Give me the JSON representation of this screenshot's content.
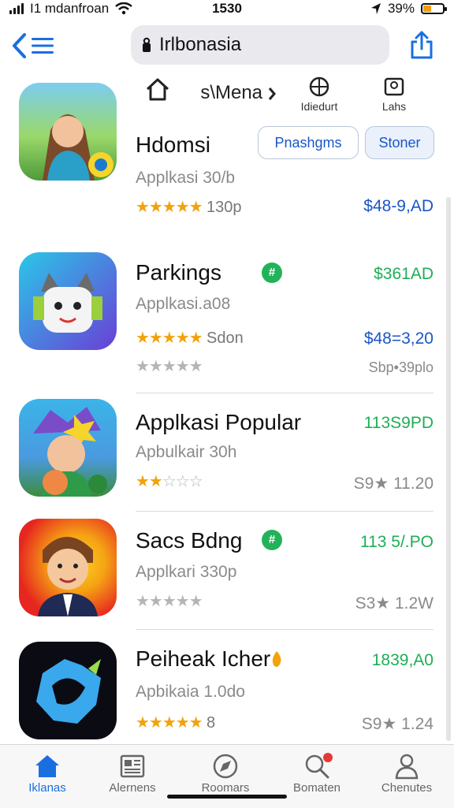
{
  "status": {
    "carrier": "I1 mdanfroan",
    "time": "1530",
    "battery": "39%"
  },
  "navbar": {
    "search_value": "Irlbonasia"
  },
  "categories": [
    {
      "label": "",
      "icon": "home-icon"
    },
    {
      "label": "s\\Mena",
      "icon": "arrow-icon"
    },
    {
      "label": "Idiedurt",
      "icon": "globe-icon"
    },
    {
      "label": "Lahs",
      "icon": "camera-icon"
    }
  ],
  "actions": {
    "primary": "Pnashgms",
    "secondary": "Stoner"
  },
  "apps": [
    {
      "title": "Hdomsi",
      "subtitle": "Applkasi 30/b",
      "rating": 4.5,
      "meta": "130p",
      "price_top": "",
      "price_bottom": "$48-9,AD",
      "price_extra": ""
    },
    {
      "title": "Parkings",
      "subtitle": "Applkasi.a08",
      "rating": 5,
      "meta": "Sdon",
      "price_top": "$361AD",
      "price_bottom": "$48=3,20",
      "price_extra": "Sbp•39plo"
    },
    {
      "title": "Applkasi Popular",
      "subtitle": "Apbulkair 30h",
      "rating": 2,
      "meta": "",
      "price_top": "113S9PD",
      "price_bottom": "S9★ 11.20",
      "price_extra": ""
    },
    {
      "title": "Sacs Bdng",
      "subtitle": "Applkari 330p",
      "rating": 0,
      "meta": "",
      "price_top": "113 5/.PO",
      "price_bottom": "S3★ 1.2W",
      "price_extra": ""
    },
    {
      "title": "Peiheak Icher",
      "subtitle": "Apbikaia 1.0do",
      "rating": 4.5,
      "meta": "8",
      "price_top": "1839,A0",
      "price_bottom": "S9★ 1.24",
      "price_extra": ""
    }
  ],
  "tabs": [
    {
      "label": "Iklanas",
      "icon": "home-icon",
      "active": true
    },
    {
      "label": "Alernens",
      "icon": "news-icon",
      "active": false
    },
    {
      "label": "Roomars",
      "icon": "compass-icon",
      "active": false
    },
    {
      "label": "Bomaten",
      "icon": "search-icon",
      "active": false
    },
    {
      "label": "Chenutes",
      "icon": "person-icon",
      "active": false
    }
  ],
  "colors": {
    "accent": "#1a6fe0",
    "star": "#f2a20b",
    "price_green": "#1fae55",
    "price_blue": "#1a56c8"
  }
}
